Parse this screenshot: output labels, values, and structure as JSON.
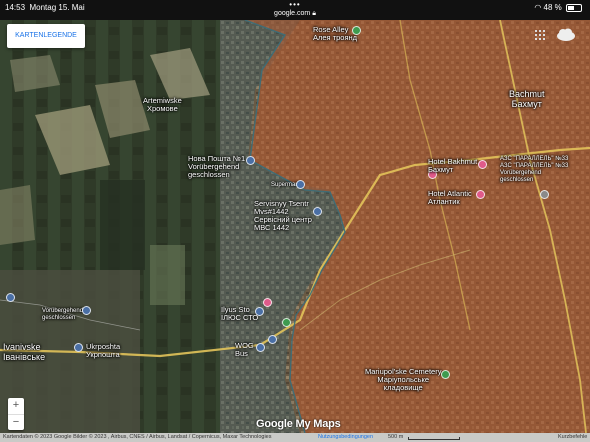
{
  "status_bar": {
    "time": "14:53",
    "date": "Montag 15. Mai",
    "url": "google.com",
    "dots": "•••",
    "battery": "48 %",
    "battery_level": 0.48
  },
  "legend_button": {
    "label": "KARTENLEGENDE"
  },
  "colors": {
    "accent": "#1a73e8",
    "occupied_overlay": "#b8582c",
    "road_yellow": "#e2c35a",
    "frontline_green": "#3a6e7a"
  },
  "icons": {
    "layers": "grid-icon",
    "weather": "cloud-icon",
    "zoom_in": "plus-icon",
    "zoom_out": "minus-icon"
  },
  "places": {
    "rose_alley": {
      "line1": "Rose Alley",
      "line2": "Алея троянд"
    },
    "artemiwske": {
      "line1": "Artemiwske",
      "line2": "Хромове"
    },
    "nova_poshta": {
      "line1": "Нова Пошта №1",
      "line2": "Vorübergehend",
      "line3": "geschlossen"
    },
    "supermarket": {
      "line1": "Supermarkt"
    },
    "servisnyy": {
      "line1": "Servisnyy Tsentr",
      "line2": "Mvs#1442",
      "line3": "Сервісний центр",
      "line4": "МВС 1442"
    },
    "bachmut": {
      "line1": "Bachmut",
      "line2": "Бахмут"
    },
    "hotel_bakhmut": {
      "line1": "Hotel Bakhmut",
      "line2": "Бахмут"
    },
    "azs": {
      "line1": "АЗС \"ПАРАЛЛЕЛЬ\" №33",
      "line2": "АЗС \"ПАРАЛЛЕЛЬ\" №33",
      "line3": "Vorübergehend",
      "line4": "geschlossen"
    },
    "hotel_atlantic": {
      "line1": "Hotel Atlantic",
      "line2": "Атлантик"
    },
    "temp_closed": {
      "line1": "Vorübergehend",
      "line2": "geschlossen"
    },
    "ivanivske": {
      "line1": "Ivanivske",
      "line2": "Іванівське"
    },
    "ukrposhta": {
      "line1": "Ukrposhta",
      "line2": "Укрпошта"
    },
    "ilyus_sto": {
      "line1": "Ilyus Sto",
      "line2": "ІЛЮС СТО"
    },
    "wog": {
      "line1": "WOG",
      "line2": "Bus"
    },
    "cemetery": {
      "line1": "Mariupol'ske Cemetery",
      "line2": "Маріупольське",
      "line3": "кладовище"
    }
  },
  "logo": {
    "text": "Google My Maps"
  },
  "attribution": {
    "text": "Kartendaten © 2023 Google Bilder © 2023 , Airbus, CNES / Airbus, Landsat / Copernicus, Maxar Technologies",
    "terms": "Nutzungsbedingungen",
    "scale": "500 m",
    "shortcuts": "Kurzbefehle"
  }
}
